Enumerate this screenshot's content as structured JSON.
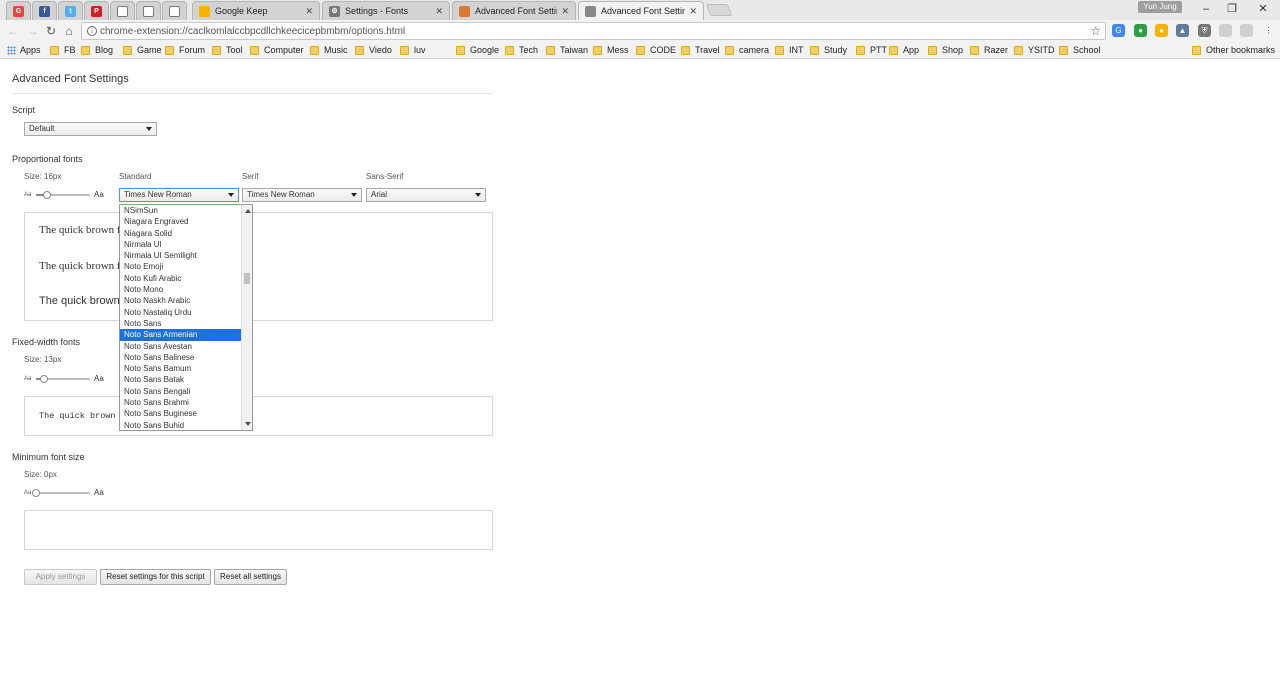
{
  "browser": {
    "pinned_tabs": [
      {
        "icon": "gmail-icon",
        "color": "#e04b3c",
        "glyph": "G"
      },
      {
        "icon": "facebook-icon",
        "color": "#3b5998",
        "glyph": "f"
      },
      {
        "icon": "twitter-icon",
        "color": "#55acee",
        "glyph": "t"
      },
      {
        "icon": "pinterest-icon",
        "color": "#cb2027",
        "glyph": "P"
      },
      {
        "icon": "page-icon",
        "color": "#ffffff",
        "glyph": ""
      },
      {
        "icon": "page-icon",
        "color": "#ffffff",
        "glyph": ""
      },
      {
        "icon": "page-icon",
        "color": "#ffffff",
        "glyph": ""
      }
    ],
    "tabs": [
      {
        "title": "Google Keep",
        "icon": "keep-icon",
        "color": "#f6b400"
      },
      {
        "title": "Settings - Fonts",
        "icon": "gear-icon",
        "color": "#777777"
      },
      {
        "title": "Advanced Font Setting",
        "icon": "font-settings-icon",
        "color": "#d97b30"
      },
      {
        "title": "Advanced Font Setting",
        "icon": "font-settings-icon",
        "color": "#888888",
        "active": true
      }
    ],
    "user": "Yun Jung",
    "url": "chrome-extension://caclkomlalccbpcdllchkeecicepbmbm/options.html",
    "bookmarks": [
      "Apps",
      "FB",
      "Blog",
      "Game",
      "Forum",
      "Tool",
      "Computer",
      "Music",
      "Viedo",
      "luv",
      "Google",
      "Tech",
      "Taiwan",
      "Mess",
      "CODE",
      "Travel",
      "camera",
      "INT",
      "Study",
      "PTT",
      "App",
      "Shop",
      "Razer",
      "YSITD",
      "School"
    ],
    "other_bookmarks": "Other bookmarks",
    "accent": "#1e6fe0"
  },
  "page": {
    "title": "Advanced Font Settings",
    "script": {
      "label": "Script",
      "value": "Default"
    },
    "proportional": {
      "label": "Proportional fonts",
      "size_label": "Size: 16px",
      "size_fraction": 0.2,
      "standard_label": "Standard",
      "serif_label": "Serif",
      "sans_label": "Sans-Serif",
      "standard_value": "Times New Roman",
      "serif_value": "Times New Roman",
      "sans_value": "Arial",
      "preview_lines": [
        "The quick brown f",
        "The quick brown f",
        "The quick brown"
      ]
    },
    "fixed": {
      "label": "Fixed-width fonts",
      "size_label": "Size: 13px",
      "size_fraction": 0.15,
      "preview": "The quick brown f"
    },
    "minimum": {
      "label": "Minimum font size",
      "size_label": "Size: 0px",
      "size_fraction": 0.0
    },
    "slider_small": "Aa",
    "slider_large": "Aa",
    "buttons": {
      "apply": "Apply settings",
      "reset_script": "Reset settings for this script",
      "reset_all": "Reset all settings"
    },
    "dropdown": {
      "items": [
        "NSimSun",
        "Niagara Engraved",
        "Niagara Solid",
        "Nirmala UI",
        "Nirmala UI Semilight",
        "Noto Emoji",
        "Noto Kufi Arabic",
        "Noto Mono",
        "Noto Naskh Arabic",
        "Noto Nastaliq Urdu",
        "Noto Sans",
        "Noto Sans Armenian",
        "Noto Sans Avestan",
        "Noto Sans Balinese",
        "Noto Sans Bamum",
        "Noto Sans Batak",
        "Noto Sans Bengali",
        "Noto Sans Brahmi",
        "Noto Sans Buginese",
        "Noto Sans Buhid"
      ],
      "selected": "Noto Sans Armenian"
    }
  }
}
